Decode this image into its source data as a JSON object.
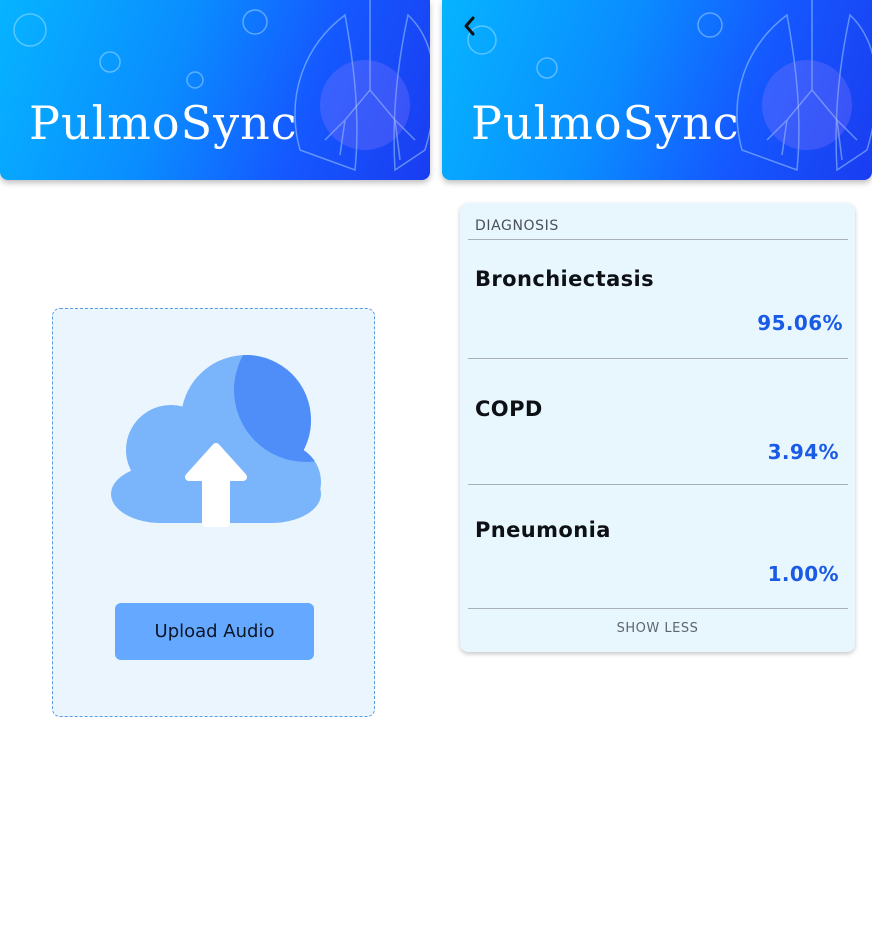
{
  "app": {
    "title": "PulmoSync"
  },
  "upload_screen": {
    "icon": "cloud-upload-icon",
    "upload_label": "Upload Audio"
  },
  "results_screen": {
    "back_icon": "chevron-left-icon",
    "diagnosis": {
      "header": "DIAGNOSIS",
      "items": [
        {
          "name": "Bronchiectasis",
          "percent": "95.06%"
        },
        {
          "name": "COPD",
          "percent": "3.94%"
        },
        {
          "name": "Pneumonia",
          "percent": "1.00%"
        }
      ],
      "toggle_label": "SHOW LESS"
    }
  },
  "colors": {
    "banner_start": "#06b4ff",
    "banner_end": "#1a3cf0",
    "panel_bg": "#eaf5fd",
    "upload_button": "#65a8ff",
    "percent_text": "#1a5be6"
  }
}
